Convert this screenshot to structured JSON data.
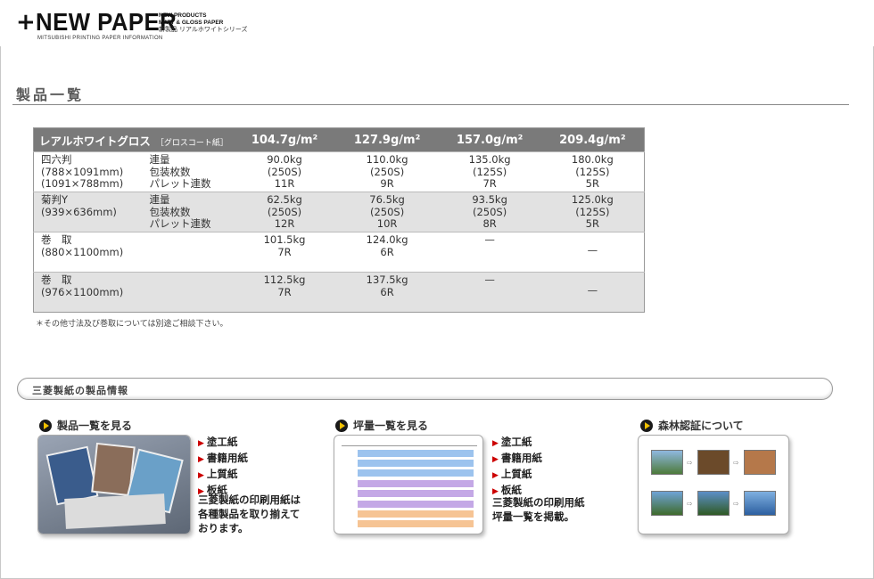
{
  "header": {
    "plus": "+",
    "brand": "NEW PAPER",
    "sub1": "NEW PRODUCTS",
    "sub2": "MATT & GLOSS PAPER",
    "sub3": "新製品 リアルホワイトシリーズ",
    "tagline": "MITSUBISHI PRINTING PAPER INFORMATION"
  },
  "section_title": "製品一覧",
  "table": {
    "product": "レアルホワイトグロス",
    "product_note": "［グロスコート紙］",
    "columns": [
      "104.7g/m²",
      "127.9g/m²",
      "157.0g/m²",
      "209.4g/m²"
    ],
    "rows": [
      {
        "size": [
          "四六判",
          "(788×1091mm)",
          "(1091×788mm)"
        ],
        "labels": [
          "連量",
          "包装枚数",
          "パレット連数"
        ],
        "cells": [
          [
            "90.0kg",
            "(250S)",
            "11R"
          ],
          [
            "110.0kg",
            "(250S)",
            "9R"
          ],
          [
            "135.0kg",
            "(125S)",
            "7R"
          ],
          [
            "180.0kg",
            "(125S)",
            "5R"
          ]
        ]
      },
      {
        "size": [
          "菊判Y",
          "(939×636mm)"
        ],
        "labels": [
          "連量",
          "包装枚数",
          "パレット連数"
        ],
        "cells": [
          [
            "62.5kg",
            "(250S)",
            "12R"
          ],
          [
            "76.5kg",
            "(250S)",
            "10R"
          ],
          [
            "93.5kg",
            "(250S)",
            "8R"
          ],
          [
            "125.0kg",
            "(125S)",
            "5R"
          ]
        ]
      },
      {
        "size": [
          "巻　取",
          "(880×1100mm)"
        ],
        "labels": [],
        "cells": [
          [
            "101.5kg",
            "7R"
          ],
          [
            "124.0kg",
            "6R"
          ],
          [
            "—"
          ],
          [
            "—"
          ]
        ]
      },
      {
        "size": [
          "巻　取",
          "(976×1100mm)"
        ],
        "labels": [],
        "cells": [
          [
            "112.5kg",
            "7R"
          ],
          [
            "137.5kg",
            "6R"
          ],
          [
            "—"
          ],
          [
            "—"
          ]
        ]
      }
    ]
  },
  "note": "＊その他寸法及び巻取については別途ご相談下さい。",
  "info_bar": "三菱製紙の製品情報",
  "cards": [
    {
      "title": "製品一覧を見る",
      "links": [
        "塗工紙",
        "書籍用紙",
        "上質紙",
        "板紙"
      ],
      "desc": [
        "三菱製紙の印刷用紙は",
        "各種製品を取り揃えて",
        "おります。"
      ]
    },
    {
      "title": "坪量一覧を見る",
      "links": [
        "塗工紙",
        "書籍用紙",
        "上質紙",
        "板紙"
      ],
      "desc": [
        "三菱製紙の印刷用紙",
        "坪量一覧を掲載。"
      ]
    },
    {
      "title": "森林認証について"
    }
  ],
  "colors": {
    "header_gray": "#7a7a7a",
    "row_shade": "#e2e2e2",
    "link_arrow": "#cc0000",
    "play_yellow": "#f2c100"
  }
}
